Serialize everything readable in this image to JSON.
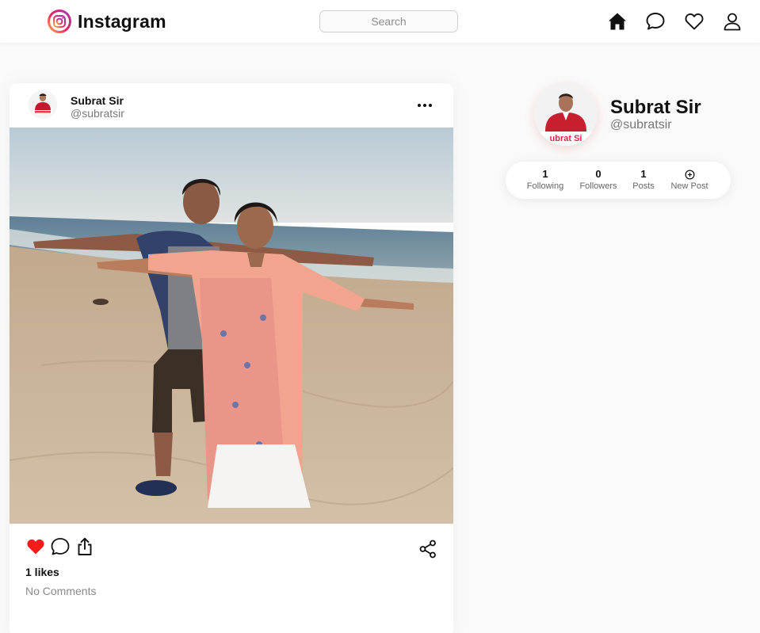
{
  "header": {
    "app_name": "Instagram",
    "search_placeholder": "Search",
    "icons": [
      "instagram-logo-icon",
      "home-icon",
      "chat-icon",
      "heart-icon",
      "user-icon"
    ]
  },
  "post": {
    "author_name": "Subrat Sir",
    "author_handle": "@subratsir",
    "likes_text": "1 likes",
    "comments_text": "No Comments",
    "liked": true,
    "like_color": "#ff1a1a",
    "actions": [
      "heart-filled-icon",
      "comment-icon",
      "share-upload-icon",
      "share-network-icon"
    ]
  },
  "profile": {
    "name": "Subrat Sir",
    "handle": "@subratsir",
    "avatar_caption": "ubrat Si",
    "stats": [
      {
        "value": "1",
        "label": "Following"
      },
      {
        "value": "0",
        "label": "Followers"
      },
      {
        "value": "1",
        "label": "Posts"
      },
      {
        "value": "",
        "label": "New Post",
        "icon": "plus-circle-icon"
      }
    ]
  }
}
